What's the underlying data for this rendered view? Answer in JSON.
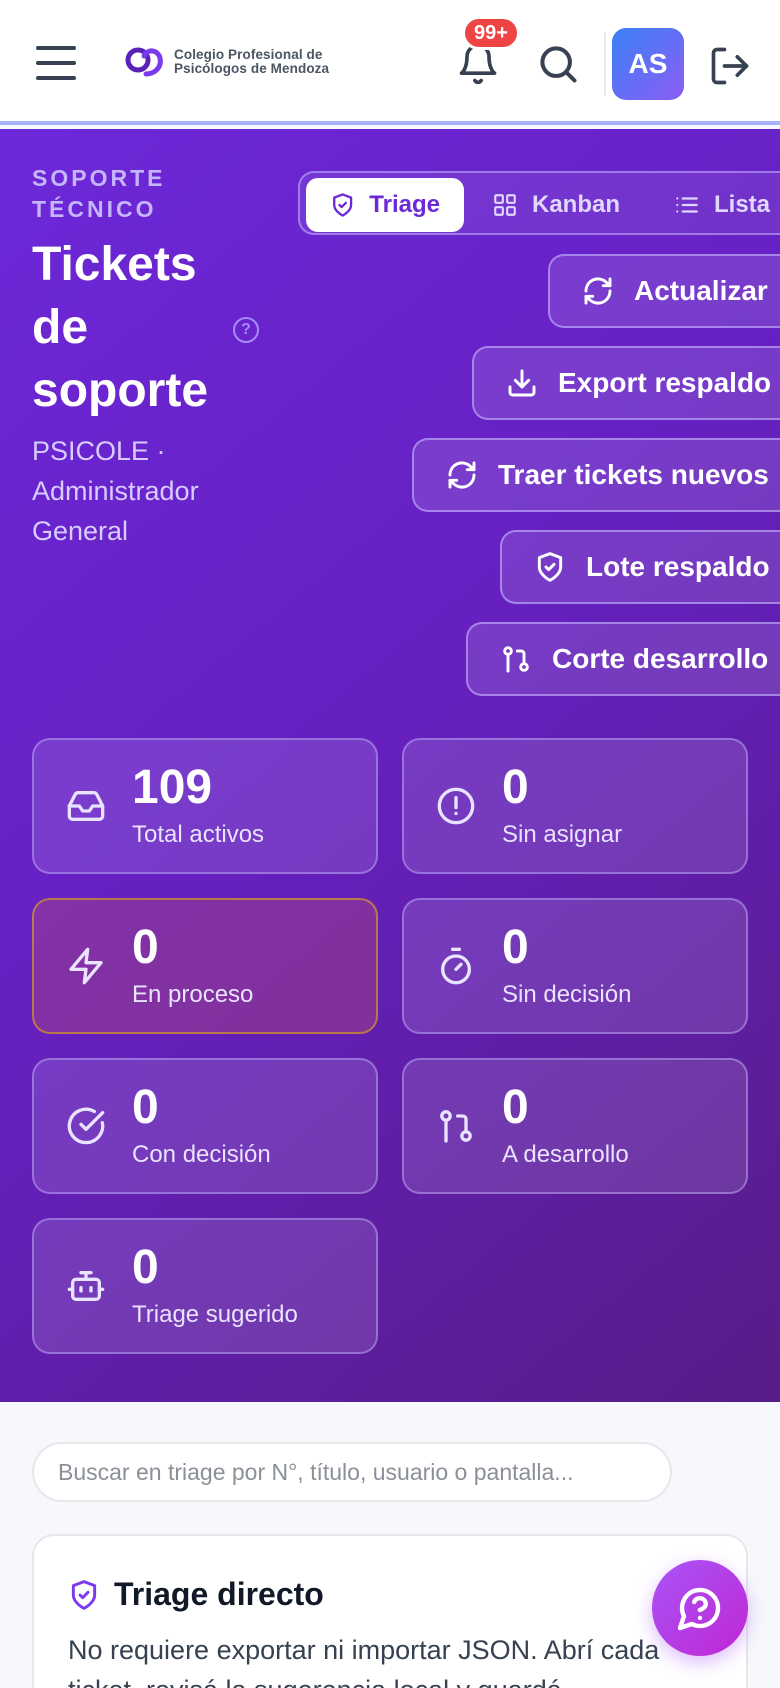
{
  "header": {
    "logo_line1": "Colegio Profesional de",
    "logo_line2": "Psicólogos de Mendoza",
    "notifications_badge": "99+",
    "avatar_initials": "AS"
  },
  "hero": {
    "eyebrow": "SOPORTE TÉCNICO",
    "title": "Tickets de soporte",
    "help_glyph": "?",
    "subtitle": "PSICOLE · Administrador General"
  },
  "view_tabs": [
    {
      "label": "Triage",
      "active": true
    },
    {
      "label": "Kanban",
      "active": false
    },
    {
      "label": "Lista",
      "active": false
    }
  ],
  "actions": {
    "refresh": "Actualizar",
    "export": "Export respaldo",
    "fetch_new": "Traer tickets nuevos",
    "batch": "Lote respaldo",
    "dev_cut": "Corte desarrollo"
  },
  "stats": [
    {
      "value": "109",
      "label": "Total activos",
      "icon": "inbox-icon"
    },
    {
      "value": "0",
      "label": "Sin asignar",
      "icon": "alert-circle-icon"
    },
    {
      "value": "0",
      "label": "En proceso",
      "icon": "lightning-icon"
    },
    {
      "value": "0",
      "label": "Sin decisión",
      "icon": "timer-icon"
    },
    {
      "value": "0",
      "label": "Con decisión",
      "icon": "check-circle-icon"
    },
    {
      "value": "0",
      "label": "A desarrollo",
      "icon": "git-pull-request-icon"
    },
    {
      "value": "0",
      "label": "Triage sugerido",
      "icon": "bot-icon"
    }
  ],
  "search": {
    "placeholder": "Buscar en triage por N°, título, usuario o pantalla..."
  },
  "triage_card": {
    "title": "Triage directo",
    "text": "No requiere exportar ni importar JSON. Abrí cada ticket, revisá la sugerencia local y guardá"
  },
  "colors": {
    "accent": "#6d28d9",
    "badge": "#ef4444",
    "fab": "#a855f7"
  }
}
